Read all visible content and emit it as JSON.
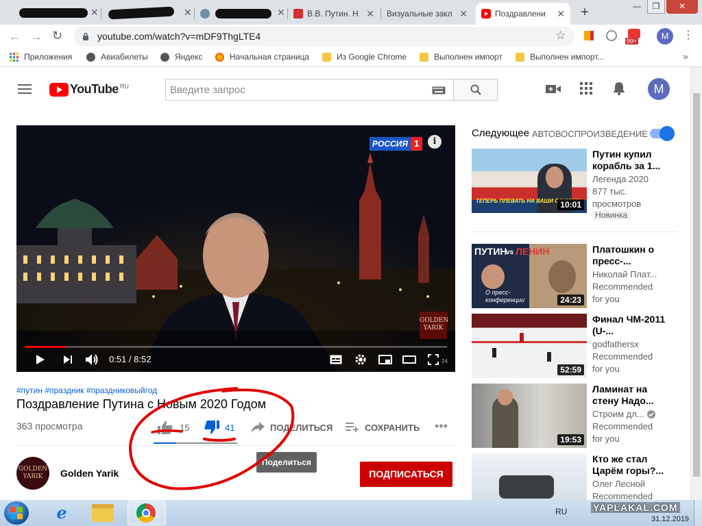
{
  "browser": {
    "tabs": [
      {
        "label": "",
        "scribbled": true
      },
      {
        "label": "",
        "scribbled": true
      },
      {
        "label": "",
        "scribbled": true
      },
      {
        "label": "В.В. Путин. Н"
      },
      {
        "label": "Визуальные закл"
      },
      {
        "label": "Поздравлени"
      }
    ],
    "url": "youtube.com/watch?v=mDF9ThgLTE4",
    "badge_count": "99+",
    "profile_initial": "M",
    "bookmarks": [
      "Приложения",
      "Авиабилеты",
      "Яндекс",
      "Начальная страница",
      "Из Google Chrome",
      "Выполнен импорт",
      "Выполнен импорт..."
    ],
    "overflow": "»"
  },
  "youtube": {
    "logo_text": "YouTube",
    "logo_region": "RU",
    "search_placeholder": "Введите запрос",
    "avatar_initial": "M"
  },
  "player": {
    "channel_badge": "РОССИЯ",
    "channel_number": "1",
    "watermark_line1": "GOLDEN",
    "watermark_line2": "YARIK",
    "time": "0:51 / 8:52",
    "progress_fraction": 0.097,
    "age_badge": "24"
  },
  "video": {
    "hashtags": "#путин #праздник #праздниковыйгод",
    "title": "Поздравление Путина с Новым 2020 Годом",
    "views": "363 просмотра",
    "likes": "15",
    "dislikes": "41",
    "share": "ПОДЕЛИТЬСЯ",
    "save": "СОХРАНИТЬ",
    "tooltip": "Поделиться",
    "channel_name": "Golden Yarik",
    "channel_avatar_line1": "GOLDEN",
    "channel_avatar_line2": "YARIK",
    "subscribe": "ПОДПИСАТЬСЯ"
  },
  "sidebar": {
    "next_label": "Следующее",
    "autoplay_label": "АВТОВОСПРОИЗВЕДЕНИЕ",
    "autoplay_on": true,
    "videos": [
      {
        "title": "Путин купил корабль за 1...",
        "channel": "Легенда 2020",
        "meta1": "877 тыс.",
        "meta2": "просмотров",
        "badge": "Новинка",
        "duration": "10:01",
        "thumb_caption": "ТЕПЕРЬ ПЛЕВАТЬ НА ВАШИ САНКЦИИ"
      },
      {
        "title": "Платошкин о пресс-...",
        "channel": "Николай Плат...",
        "meta1": "Recommended",
        "meta2": "for you",
        "duration": "24:23",
        "thumb_word1": "ПУТИН",
        "thumb_vs": "vs",
        "thumb_word2": "ЛЕНИН",
        "thumb_caption1": "О пресс-",
        "thumb_caption2": "конференции"
      },
      {
        "title": "Финал ЧМ-2011 (U-...",
        "channel": "godfathersx",
        "meta1": "Recommended",
        "meta2": "for you",
        "duration": "52:59"
      },
      {
        "title": "Ламинат на стену Надо...",
        "channel": "Строим дл...",
        "meta1": "Recommended",
        "meta2": "for you",
        "duration": "19:53",
        "verified": true
      },
      {
        "title": "Кто же стал Царём горы?...",
        "channel": "Олег Лесной",
        "meta1": "Recommended",
        "meta2": ""
      }
    ]
  },
  "overlay": {
    "watermark": "YAPLAKAL.COM"
  },
  "taskbar": {
    "language": "RU",
    "date": "31.12.2019"
  },
  "colors": {
    "yt_red": "#ff0000",
    "subscribe_red": "#cc0000",
    "link_blue": "#065fd4",
    "annotation_red": "#e00000",
    "autoplay_blue": "#1a73e8"
  }
}
